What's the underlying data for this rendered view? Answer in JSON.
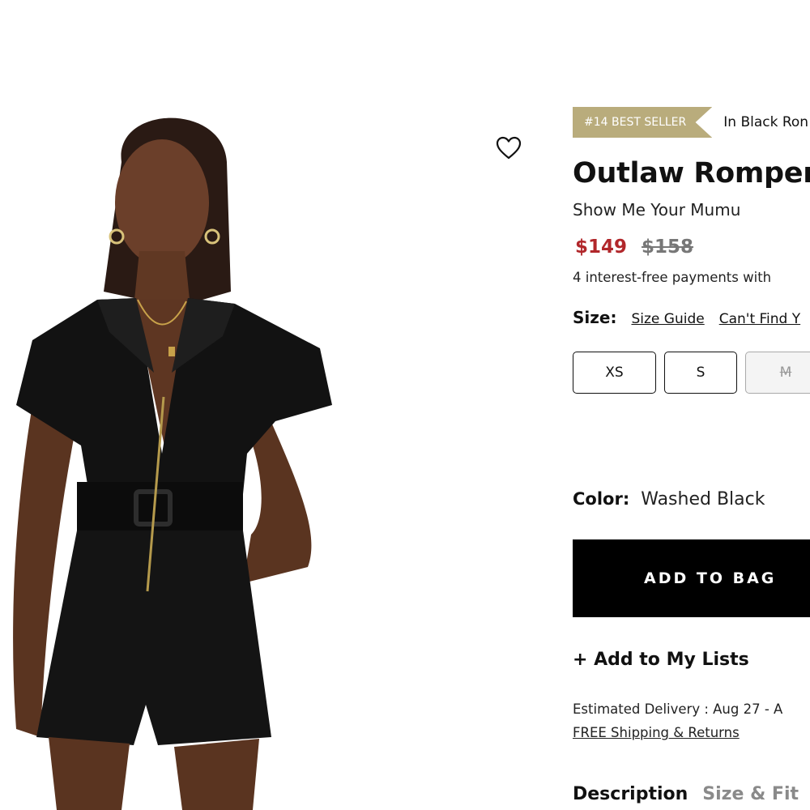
{
  "product": {
    "badge": "#14 BEST SELLER",
    "badge_category": "In Black Ron",
    "title": "Outlaw Romper",
    "brand": "Show Me Your Mumu",
    "price_sale": "$149",
    "price_original": "$158",
    "installments": "4 interest-free payments with"
  },
  "size": {
    "label": "Size:",
    "guide_link": "Size Guide",
    "cant_find_link": "Can't Find Y",
    "options": [
      "XS",
      "S",
      "M"
    ]
  },
  "color": {
    "label": "Color:",
    "value": "Washed Black"
  },
  "actions": {
    "add_to_bag": "ADD TO BAG",
    "add_to_lists": "+ Add to My Lists"
  },
  "shipping": {
    "estimated_delivery": "Estimated Delivery : Aug 27 - A",
    "free_shipping": "FREE Shipping & Returns"
  },
  "tabs": [
    "Description",
    "Size & Fit"
  ],
  "colors": {
    "sale": "#b1272b",
    "badge": "#b9ac7c",
    "button": "#000000"
  },
  "icons": {
    "wishlist": "heart-outline-icon"
  }
}
